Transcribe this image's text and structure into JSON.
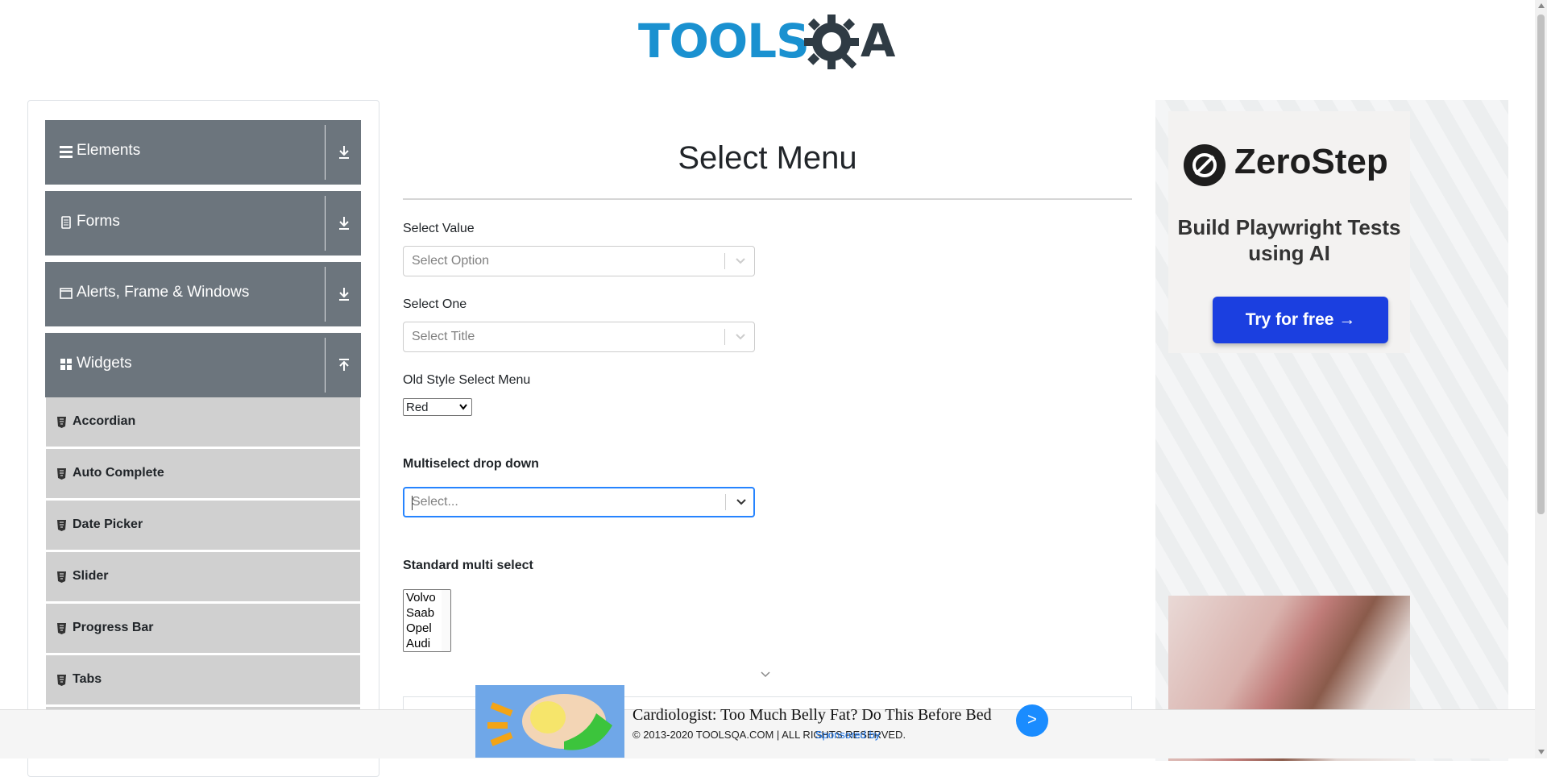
{
  "header": {
    "logo_text_primary": "TOOLS",
    "logo_text_secondary": "A"
  },
  "sidebar": {
    "groups": [
      {
        "label": "Elements",
        "icon": "hamburger-icon",
        "toggle": "download-icon"
      },
      {
        "label": "Forms",
        "icon": "document-icon",
        "toggle": "download-icon"
      },
      {
        "label": "Alerts, Frame & Windows",
        "icon": "window-icon",
        "toggle": "download-icon"
      },
      {
        "label": "Widgets",
        "icon": "grid-icon",
        "toggle": "upload-icon"
      }
    ],
    "widget_items": [
      {
        "label": "Accordian"
      },
      {
        "label": "Auto Complete"
      },
      {
        "label": "Date Picker"
      },
      {
        "label": "Slider"
      },
      {
        "label": "Progress Bar"
      },
      {
        "label": "Tabs"
      }
    ]
  },
  "main": {
    "title": "Select Menu",
    "select_value": {
      "label": "Select Value",
      "placeholder": "Select Option"
    },
    "select_one": {
      "label": "Select One",
      "placeholder": "Select Title"
    },
    "old_style": {
      "label": "Old Style Select Menu",
      "selected": "Red"
    },
    "multiselect": {
      "label": "Multiselect drop down",
      "placeholder": "Select..."
    },
    "standard_multi": {
      "label": "Standard multi select",
      "options": [
        "Volvo",
        "Saab",
        "Opel",
        "Audi"
      ]
    }
  },
  "ad": {
    "brand": "ZeroStep",
    "tagline": "Build Playwright Tests using AI",
    "cta": "Try for free →",
    "accent": "#1b3fe0"
  },
  "bottom": {
    "footer": "© 2013-2020 TOOLSQA.COM | ALL RIGHTS RESERVED.",
    "sponsor_link": "Sponsored by",
    "banner_headline": "Cardiologist: Too Much Belly Fat? Do This Before Bed",
    "banner_button": ">"
  },
  "colors": {
    "sidebar_group": "#6c757d",
    "sidebar_item": "#d0d0d0",
    "logo_blue": "#1a91d0",
    "focus": "#2684ff"
  }
}
